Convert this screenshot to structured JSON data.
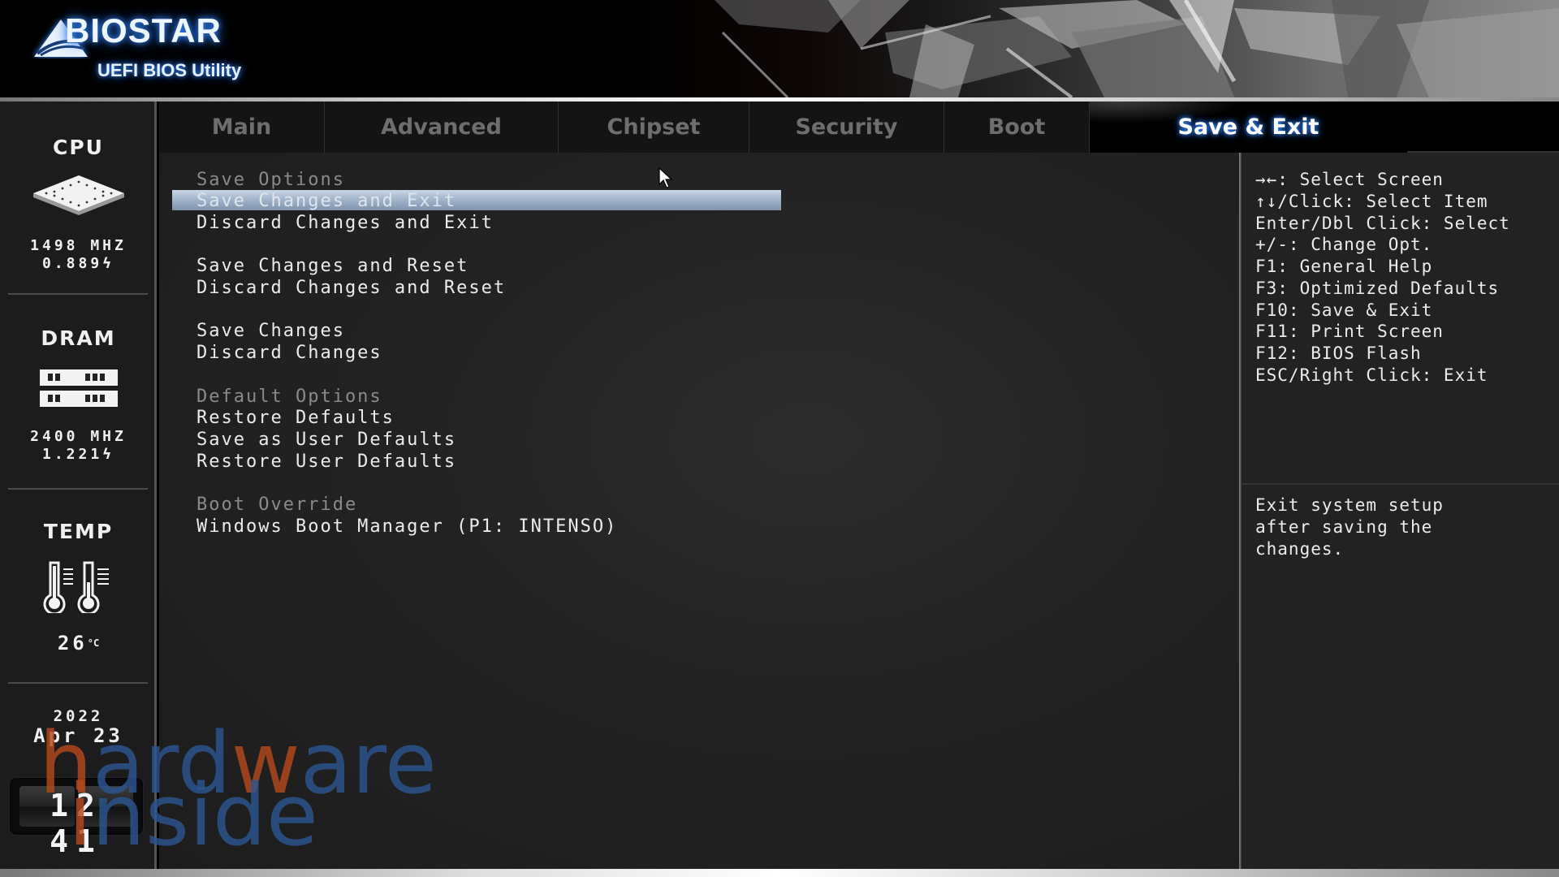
{
  "header": {
    "brand": "BIOSTAR",
    "subtitle": "UEFI BIOS Utility"
  },
  "tabs": [
    {
      "label": "Main",
      "active": false
    },
    {
      "label": "Advanced",
      "active": false
    },
    {
      "label": "Chipset",
      "active": false
    },
    {
      "label": "Security",
      "active": false
    },
    {
      "label": "Boot",
      "active": false
    },
    {
      "label": "Save & Exit",
      "active": true
    }
  ],
  "sidebar": {
    "cpu": {
      "title": "CPU",
      "icon": "cpu-chip-icon",
      "frequency": "1498 MHZ",
      "voltage": "0.889"
    },
    "dram": {
      "title": "DRAM",
      "icon": "memory-module-icon",
      "frequency": "2400 MHZ",
      "voltage": "1.221"
    },
    "temp": {
      "title": "TEMP",
      "icon": "thermometer-icon",
      "value": "26",
      "unit": "°C"
    },
    "date": {
      "year": "2022",
      "month_day": "Apr 23"
    },
    "time": "12 41"
  },
  "menu": {
    "sections": [
      {
        "header": "Save Options",
        "items": [
          "Save Changes and Exit",
          "Discard Changes and Exit"
        ]
      },
      {
        "header": "",
        "items": [
          "Save Changes and Reset",
          "Discard Changes and Reset"
        ]
      },
      {
        "header": "",
        "items": [
          "Save Changes",
          "Discard Changes"
        ]
      },
      {
        "header": "Default Options",
        "items": [
          "Restore Defaults",
          "Save as User Defaults",
          "Restore User Defaults"
        ]
      },
      {
        "header": "Boot Override",
        "items": [
          "Windows Boot Manager (P1: INTENSO)"
        ]
      }
    ],
    "selected": "Save Changes and Exit"
  },
  "help": {
    "keys": [
      "→←: Select Screen",
      "↑↓/Click: Select Item",
      "Enter/Dbl Click: Select",
      "+/-: Change Opt.",
      "F1: General Help",
      "F3: Optimized Defaults",
      "F10: Save & Exit",
      "F11: Print Screen",
      "F12: BIOS Flash",
      "ESC/Right Click: Exit"
    ],
    "description": [
      "Exit system setup",
      "after saving the",
      "changes."
    ]
  },
  "watermark": {
    "line1_a": "h",
    "line1_b": "ard",
    "line1_c": "w",
    "line1_d": "are",
    "line2_a": "i",
    "line2_b": "nside"
  },
  "colors": {
    "accent_glow": "#3b8cff",
    "highlight_bar": "#9fb2c8",
    "watermark_blue": "#2c5590",
    "watermark_orange": "#b4491c"
  }
}
